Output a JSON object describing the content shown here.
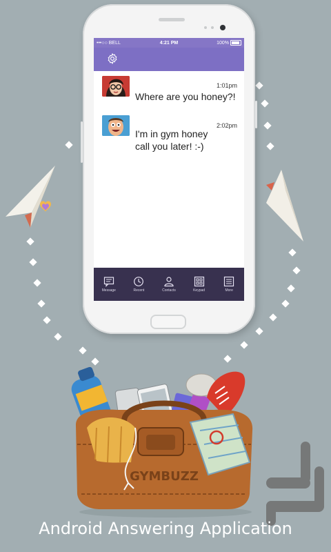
{
  "status_bar": {
    "carrier": "•••○○ BELL",
    "time": "4:21 PM",
    "battery": "100%"
  },
  "app_bar": {
    "settings_icon": "gear-icon",
    "accent_color": "#7d6fc4"
  },
  "messages": [
    {
      "time": "1:01pm",
      "text": "Where are you honey?!",
      "avatar": "woman-glasses-avatar"
    },
    {
      "time": "2:02pm",
      "text": "I'm in  gym honey\ncall you later! :-)",
      "avatar": "man-avatar"
    }
  ],
  "tabs": [
    {
      "label": "Message",
      "icon": "message-icon"
    },
    {
      "label": "Recent",
      "icon": "clock-icon"
    },
    {
      "label": "Contacts",
      "icon": "person-icon"
    },
    {
      "label": "Keypad",
      "icon": "keypad-icon"
    },
    {
      "label": "More",
      "icon": "list-icon"
    }
  ],
  "caption": "Android Answering Application",
  "bag_brand": "GYMBUZZ",
  "colors": {
    "background": "#a2aeb2",
    "tab_bar": "#38314f",
    "status_bar": "#8576c6"
  }
}
